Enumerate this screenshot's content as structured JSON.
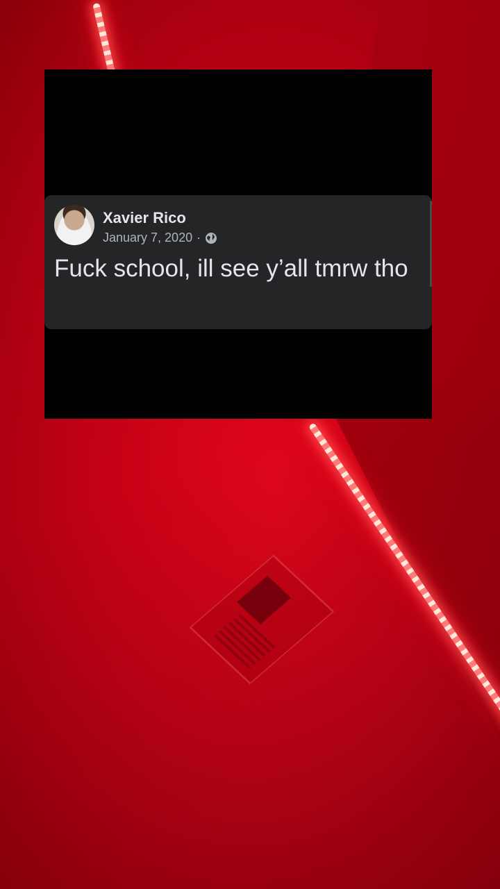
{
  "post": {
    "author": "Xavier Rico",
    "date": "January 7, 2020",
    "separator": "·",
    "text": "Fuck school, ill see y’all tmrw tho"
  },
  "icons": {
    "audience": "globe-icon",
    "avatar": "profile-photo"
  },
  "colors": {
    "overlay_background": "#000000",
    "card_background": "#242526",
    "primary_text": "#e4e6eb",
    "secondary_text": "#b0b3b8",
    "ambient_red": "#c80216"
  }
}
